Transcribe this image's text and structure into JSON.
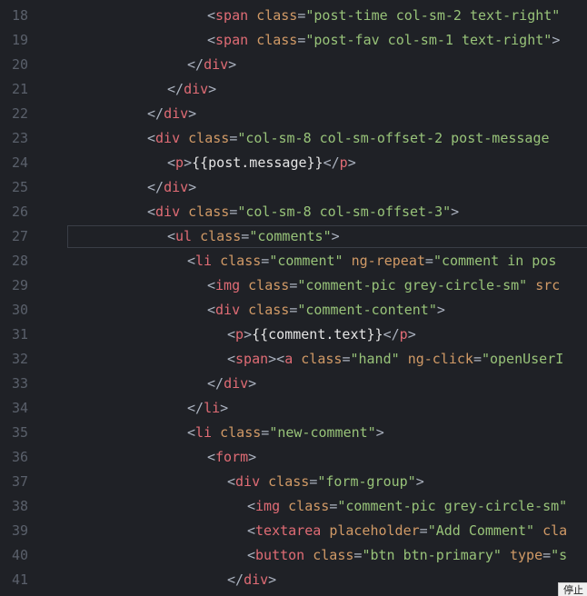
{
  "editor": {
    "current_line": 27,
    "lines": [
      {
        "number": "18",
        "indent": 7,
        "tokens": [
          {
            "k": "p",
            "t": "<"
          },
          {
            "k": "t",
            "t": "span"
          },
          {
            "k": "p",
            "t": " "
          },
          {
            "k": "a",
            "t": "class"
          },
          {
            "k": "p",
            "t": "="
          },
          {
            "k": "s",
            "t": "\"post-time col-sm-2 text-right\""
          }
        ]
      },
      {
        "number": "19",
        "indent": 7,
        "tokens": [
          {
            "k": "p",
            "t": "<"
          },
          {
            "k": "t",
            "t": "span"
          },
          {
            "k": "p",
            "t": " "
          },
          {
            "k": "a",
            "t": "class"
          },
          {
            "k": "p",
            "t": "="
          },
          {
            "k": "s",
            "t": "\"post-fav col-sm-1 text-right\""
          },
          {
            "k": "p",
            "t": ">"
          }
        ]
      },
      {
        "number": "20",
        "indent": 6,
        "tokens": [
          {
            "k": "p",
            "t": "</"
          },
          {
            "k": "t",
            "t": "div"
          },
          {
            "k": "p",
            "t": ">"
          }
        ]
      },
      {
        "number": "21",
        "indent": 5,
        "tokens": [
          {
            "k": "p",
            "t": "</"
          },
          {
            "k": "t",
            "t": "div"
          },
          {
            "k": "p",
            "t": ">"
          }
        ]
      },
      {
        "number": "22",
        "indent": 4,
        "tokens": [
          {
            "k": "p",
            "t": "</"
          },
          {
            "k": "t",
            "t": "div"
          },
          {
            "k": "p",
            "t": ">"
          }
        ]
      },
      {
        "number": "23",
        "indent": 4,
        "tokens": [
          {
            "k": "p",
            "t": "<"
          },
          {
            "k": "t",
            "t": "div"
          },
          {
            "k": "p",
            "t": " "
          },
          {
            "k": "a",
            "t": "class"
          },
          {
            "k": "p",
            "t": "="
          },
          {
            "k": "s",
            "t": "\"col-sm-8 col-sm-offset-2 post-message"
          }
        ]
      },
      {
        "number": "24",
        "indent": 5,
        "tokens": [
          {
            "k": "p",
            "t": "<"
          },
          {
            "k": "t",
            "t": "p"
          },
          {
            "k": "p",
            "t": ">"
          },
          {
            "k": "x",
            "t": "{{post.message}}"
          },
          {
            "k": "p",
            "t": "</"
          },
          {
            "k": "t",
            "t": "p"
          },
          {
            "k": "p",
            "t": ">"
          }
        ]
      },
      {
        "number": "25",
        "indent": 4,
        "tokens": [
          {
            "k": "p",
            "t": "</"
          },
          {
            "k": "t",
            "t": "div"
          },
          {
            "k": "p",
            "t": ">"
          }
        ]
      },
      {
        "number": "26",
        "indent": 4,
        "tokens": [
          {
            "k": "p",
            "t": "<"
          },
          {
            "k": "t",
            "t": "div"
          },
          {
            "k": "p",
            "t": " "
          },
          {
            "k": "a",
            "t": "class"
          },
          {
            "k": "p",
            "t": "="
          },
          {
            "k": "s",
            "t": "\"col-sm-8 col-sm-offset-3\""
          },
          {
            "k": "p",
            "t": ">"
          }
        ]
      },
      {
        "number": "27",
        "indent": 5,
        "tokens": [
          {
            "k": "p",
            "t": "<"
          },
          {
            "k": "t",
            "t": "ul"
          },
          {
            "k": "p",
            "t": " "
          },
          {
            "k": "a",
            "t": "class"
          },
          {
            "k": "p",
            "t": "="
          },
          {
            "k": "s",
            "t": "\"comments\""
          },
          {
            "k": "p",
            "t": ">"
          }
        ]
      },
      {
        "number": "28",
        "indent": 6,
        "tokens": [
          {
            "k": "p",
            "t": "<"
          },
          {
            "k": "t",
            "t": "li"
          },
          {
            "k": "p",
            "t": " "
          },
          {
            "k": "a",
            "t": "class"
          },
          {
            "k": "p",
            "t": "="
          },
          {
            "k": "s",
            "t": "\"comment\""
          },
          {
            "k": "p",
            "t": " "
          },
          {
            "k": "a",
            "t": "ng-repeat"
          },
          {
            "k": "p",
            "t": "="
          },
          {
            "k": "s",
            "t": "\"comment in pos"
          }
        ]
      },
      {
        "number": "29",
        "indent": 7,
        "tokens": [
          {
            "k": "p",
            "t": "<"
          },
          {
            "k": "t",
            "t": "img"
          },
          {
            "k": "p",
            "t": " "
          },
          {
            "k": "a",
            "t": "class"
          },
          {
            "k": "p",
            "t": "="
          },
          {
            "k": "s",
            "t": "\"comment-pic grey-circle-sm\""
          },
          {
            "k": "p",
            "t": " "
          },
          {
            "k": "a",
            "t": "src"
          }
        ]
      },
      {
        "number": "30",
        "indent": 7,
        "tokens": [
          {
            "k": "p",
            "t": "<"
          },
          {
            "k": "t",
            "t": "div"
          },
          {
            "k": "p",
            "t": " "
          },
          {
            "k": "a",
            "t": "class"
          },
          {
            "k": "p",
            "t": "="
          },
          {
            "k": "s",
            "t": "\"comment-content\""
          },
          {
            "k": "p",
            "t": ">"
          }
        ]
      },
      {
        "number": "31",
        "indent": 8,
        "tokens": [
          {
            "k": "p",
            "t": "<"
          },
          {
            "k": "t",
            "t": "p"
          },
          {
            "k": "p",
            "t": ">"
          },
          {
            "k": "x",
            "t": "{{comment.text}}"
          },
          {
            "k": "p",
            "t": "</"
          },
          {
            "k": "t",
            "t": "p"
          },
          {
            "k": "p",
            "t": ">"
          }
        ]
      },
      {
        "number": "32",
        "indent": 8,
        "tokens": [
          {
            "k": "p",
            "t": "<"
          },
          {
            "k": "t",
            "t": "span"
          },
          {
            "k": "p",
            "t": "><"
          },
          {
            "k": "t",
            "t": "a"
          },
          {
            "k": "p",
            "t": " "
          },
          {
            "k": "a",
            "t": "class"
          },
          {
            "k": "p",
            "t": "="
          },
          {
            "k": "s",
            "t": "\"hand\""
          },
          {
            "k": "p",
            "t": " "
          },
          {
            "k": "a",
            "t": "ng-click"
          },
          {
            "k": "p",
            "t": "="
          },
          {
            "k": "s",
            "t": "\"openUserI"
          }
        ]
      },
      {
        "number": "33",
        "indent": 7,
        "tokens": [
          {
            "k": "p",
            "t": "</"
          },
          {
            "k": "t",
            "t": "div"
          },
          {
            "k": "p",
            "t": ">"
          }
        ]
      },
      {
        "number": "34",
        "indent": 6,
        "tokens": [
          {
            "k": "p",
            "t": "</"
          },
          {
            "k": "t",
            "t": "li"
          },
          {
            "k": "p",
            "t": ">"
          }
        ]
      },
      {
        "number": "35",
        "indent": 6,
        "tokens": [
          {
            "k": "p",
            "t": "<"
          },
          {
            "k": "t",
            "t": "li"
          },
          {
            "k": "p",
            "t": " "
          },
          {
            "k": "a",
            "t": "class"
          },
          {
            "k": "p",
            "t": "="
          },
          {
            "k": "s",
            "t": "\"new-comment\""
          },
          {
            "k": "p",
            "t": ">"
          }
        ]
      },
      {
        "number": "36",
        "indent": 7,
        "tokens": [
          {
            "k": "p",
            "t": "<"
          },
          {
            "k": "t",
            "t": "form"
          },
          {
            "k": "p",
            "t": ">"
          }
        ]
      },
      {
        "number": "37",
        "indent": 8,
        "tokens": [
          {
            "k": "p",
            "t": "<"
          },
          {
            "k": "t",
            "t": "div"
          },
          {
            "k": "p",
            "t": " "
          },
          {
            "k": "a",
            "t": "class"
          },
          {
            "k": "p",
            "t": "="
          },
          {
            "k": "s",
            "t": "\"form-group\""
          },
          {
            "k": "p",
            "t": ">"
          }
        ]
      },
      {
        "number": "38",
        "indent": 9,
        "tokens": [
          {
            "k": "p",
            "t": "<"
          },
          {
            "k": "t",
            "t": "img"
          },
          {
            "k": "p",
            "t": " "
          },
          {
            "k": "a",
            "t": "class"
          },
          {
            "k": "p",
            "t": "="
          },
          {
            "k": "s",
            "t": "\"comment-pic grey-circle-sm\""
          }
        ]
      },
      {
        "number": "39",
        "indent": 9,
        "tokens": [
          {
            "k": "p",
            "t": "<"
          },
          {
            "k": "t",
            "t": "textarea"
          },
          {
            "k": "p",
            "t": " "
          },
          {
            "k": "a",
            "t": "placeholder"
          },
          {
            "k": "p",
            "t": "="
          },
          {
            "k": "s",
            "t": "\"Add Comment\""
          },
          {
            "k": "p",
            "t": " "
          },
          {
            "k": "a",
            "t": "cla"
          }
        ]
      },
      {
        "number": "40",
        "indent": 9,
        "tokens": [
          {
            "k": "p",
            "t": "<"
          },
          {
            "k": "t",
            "t": "button"
          },
          {
            "k": "p",
            "t": " "
          },
          {
            "k": "a",
            "t": "class"
          },
          {
            "k": "p",
            "t": "="
          },
          {
            "k": "s",
            "t": "\"btn btn-primary\""
          },
          {
            "k": "p",
            "t": " "
          },
          {
            "k": "a",
            "t": "type"
          },
          {
            "k": "p",
            "t": "="
          },
          {
            "k": "s",
            "t": "\"s"
          }
        ]
      },
      {
        "number": "41",
        "indent": 8,
        "tokens": [
          {
            "k": "p",
            "t": "</"
          },
          {
            "k": "t",
            "t": "div"
          },
          {
            "k": "p",
            "t": ">"
          }
        ]
      }
    ]
  },
  "tooltip": {
    "text": "停止"
  }
}
